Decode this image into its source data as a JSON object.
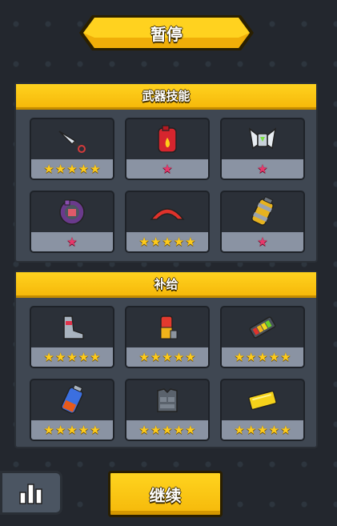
{
  "title": "暂停",
  "weapons_section": {
    "header": "武器技能",
    "items": [
      {
        "icon": "kunai-icon",
        "stars": 5,
        "star_color": "gold"
      },
      {
        "icon": "molotov-canister-icon",
        "stars": 1,
        "star_color": "pink"
      },
      {
        "icon": "guardian-shield-icon",
        "stars": 1,
        "star_color": "pink"
      },
      {
        "icon": "drone-icon",
        "stars": 1,
        "star_color": "pink"
      },
      {
        "icon": "boomerang-icon",
        "stars": 5,
        "star_color": "gold"
      },
      {
        "icon": "grenade-canister-icon",
        "stars": 1,
        "star_color": "pink"
      }
    ]
  },
  "supplies_section": {
    "header": "补给",
    "items": [
      {
        "icon": "armored-boot-icon",
        "stars": 5,
        "star_color": "gold"
      },
      {
        "icon": "energy-drink-icon",
        "stars": 5,
        "star_color": "gold"
      },
      {
        "icon": "battery-pack-icon",
        "stars": 5,
        "star_color": "gold"
      },
      {
        "icon": "fuel-cell-icon",
        "stars": 5,
        "star_color": "gold"
      },
      {
        "icon": "armor-vest-icon",
        "stars": 5,
        "star_color": "gold"
      },
      {
        "icon": "gold-ticket-icon",
        "stars": 5,
        "star_color": "gold"
      }
    ]
  },
  "buttons": {
    "continue_label": "继续",
    "stats_icon": "bar-chart-icon"
  },
  "colors": {
    "accent_yellow": "#ffd21f",
    "panel_bg": "#3f4752",
    "card_bg": "#2b3038",
    "star_gold": "#ffcc1a",
    "star_pink": "#e8386b"
  }
}
